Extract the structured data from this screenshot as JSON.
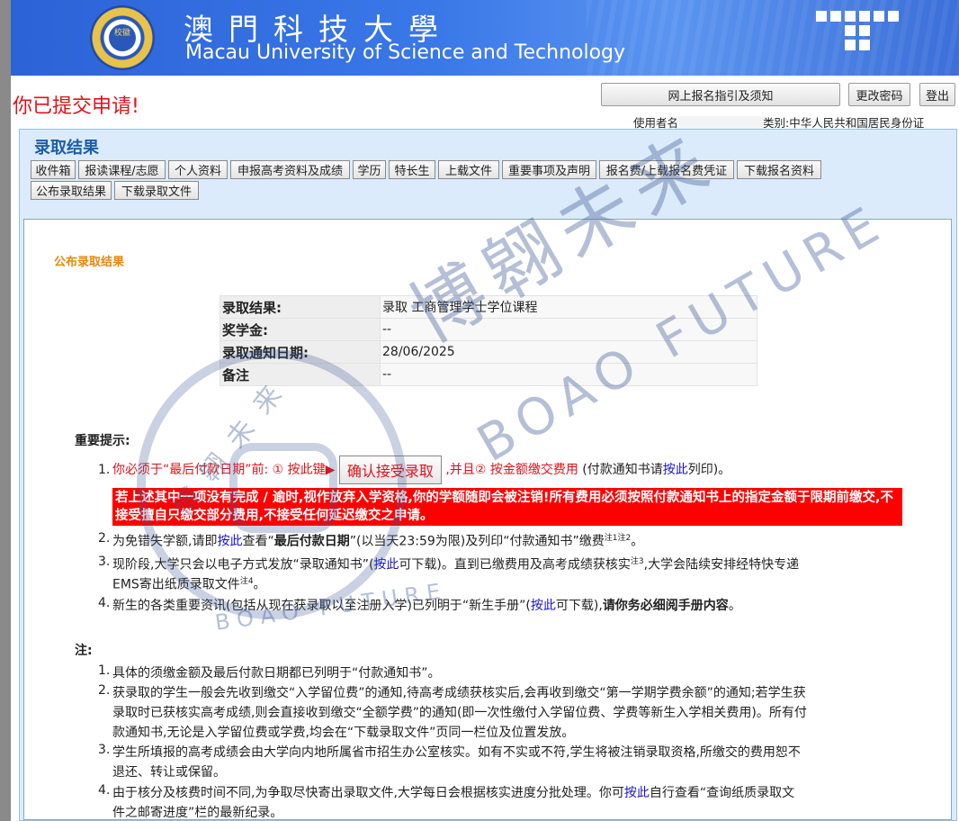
{
  "banner": {
    "seal_text": "校徽",
    "cn_name": "澳門科技大學",
    "en_name": "Macau University of Science and Technology"
  },
  "status_message": "你已提交申请!",
  "top_buttons": {
    "guide": "网上报名指引及须知",
    "change_password": "更改密码",
    "logout": "登出"
  },
  "user_line": {
    "user_label": "使用者名",
    "doc_type": "类别:中华人民共和国居民身份证"
  },
  "panel_title": "录取结果",
  "tabs": [
    "收件箱",
    "报读课程/志愿",
    "个人资料",
    "申报高考资料及成绩",
    "学历",
    "特长生",
    "上载文件",
    "重要事项及声明",
    "报名费/上载报名费凭证",
    "下载报名资料",
    "公布录取结果",
    "下载录取文件"
  ],
  "section_title": "公布录取结果",
  "result_table": [
    {
      "label": "录取结果:",
      "value": "录取 工商管理学士学位课程"
    },
    {
      "label": "奖学金:",
      "value": "--"
    },
    {
      "label": "录取通知日期:",
      "value": "28/06/2025"
    },
    {
      "label": "备注",
      "value": "--"
    }
  ],
  "important": {
    "title": "重要提示:",
    "nums": [
      "1.",
      "2.",
      "3.",
      "4."
    ],
    "item1": {
      "a": "你必须于“最后付款日期”前: ① 按此键▶",
      "button": "确认接受录取",
      "b": ",并且② 按金额缴交费用",
      "c": "(付款通知书请",
      "link": "按此",
      "d": "列印)。"
    },
    "warning": "若上述其中一项没有完成 / 逾时,视作放弃入学资格,你的学额随即会被注销!所有费用必须按照付款通知书上的指定金额于限期前缴交,不接受擅自只缴交部分费用,不接受任何延迟缴交之申请。",
    "item2": {
      "a": "为免错失学额,请即",
      "link": "按此",
      "b": "查看“",
      "bold": "最后付款日期",
      "c": "”(以当天23:59为限)及列印“付款通知书”缴费",
      "sup": "注1注2",
      "d": "。"
    },
    "item3": {
      "a": "现阶段,大学只会以电子方式发放“录取通知书”(",
      "link": "按此",
      "b": "可下载)。直到已缴费用及高考成绩获核实",
      "sup1": "注3",
      "c": ",大学会陆续安排经特快专递",
      "d": "EMS寄出纸质录取文件",
      "sup2": "注4",
      "e": "。"
    },
    "item4": {
      "a": "新生的各类重要资讯(包括从现在获录取以至注册入学)已列明于“新生手册”(",
      "link": "按此",
      "b": "可下载),",
      "bold": "请你务必细阅手册内容",
      "c": "。"
    }
  },
  "notes": {
    "title": "注:",
    "nums": [
      "1.",
      "2.",
      "3.",
      "4."
    ],
    "n1": "具体的须缴金额及最后付款日期都已列明于“付款通知书”。",
    "n2_l1": "获录取的学生一般会先收到缴交“入学留位费”的通知,待高考成绩获核实后,会再收到缴交“第一学期学费余额”的通知;若学生获",
    "n2_l2": "录取时已获核实高考成绩,则会直接收到缴交“全额学费”的通知(即一次性缴付入学留位费、学费等新生入学相关费用)。所有付",
    "n2_l3": "款通知书,无论是入学留位费或学费,均会在“下载录取文件”页同一栏位及位置发放。",
    "n3_l1": "学生所填报的高考成绩会由大学向内地所属省市招生办公室核实。如有不实或不符,学生将被注销录取资格,所缴交的费用恕不",
    "n3_l2": "退还、转让或保留。",
    "n4_l1a": "由于核分及核费时间不同,为争取尽快寄出录取文件,大学每日会根据核实进度分批处理。你可",
    "n4_link": "按此",
    "n4_l1b": "自行查看“查询纸质录取文",
    "n4_l2": "件之邮寄进度”栏的最新纪录。"
  },
  "watermark": {
    "cn_big": "博翱未来",
    "en_big": "BOAO FUTURE",
    "cn_small": "博翱未来",
    "en_small": "BOAO FUTURE"
  }
}
